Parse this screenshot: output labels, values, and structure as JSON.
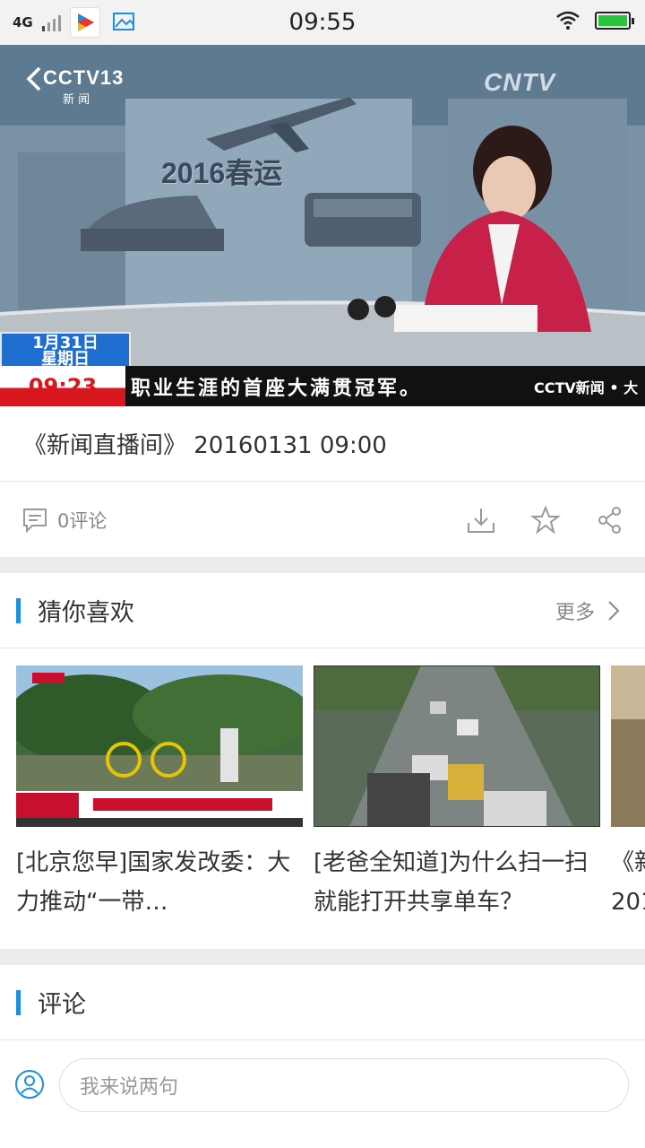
{
  "status_bar": {
    "network": "4G",
    "time": "09:55",
    "icons": [
      "signal-icon",
      "video-app-icon",
      "gallery-icon",
      "wifi-icon",
      "battery-icon"
    ],
    "battery_level": 1.0
  },
  "video": {
    "channel_logo": "CCTV13",
    "channel_sub": "新 闻",
    "corner_logo": "CNTV",
    "backdrop_text": "2016春运",
    "date_line1": "1月31日",
    "date_line2": "星期日",
    "ticker_time": "09:23",
    "ticker_text": "职业生涯的首座大满贯冠军。",
    "ticker_logo": "CCTV新闻 • 大"
  },
  "title": "《新闻直播间》 20160131 09:00",
  "actions": {
    "comment_count": "0评论"
  },
  "recommend": {
    "title": "猜你喜欢",
    "more": "更多",
    "cards": [
      {
        "caption": "[北京您早]国家发改委：大力推动“一带…"
      },
      {
        "caption": "[老爸全知道]为什么扫一扫就能打开共享单车？"
      },
      {
        "caption": "《新 201"
      }
    ]
  },
  "comments": {
    "title": "评论",
    "placeholder": "我来说两句"
  },
  "colors": {
    "accent": "#1e8fe0",
    "divider": "#ececec"
  }
}
